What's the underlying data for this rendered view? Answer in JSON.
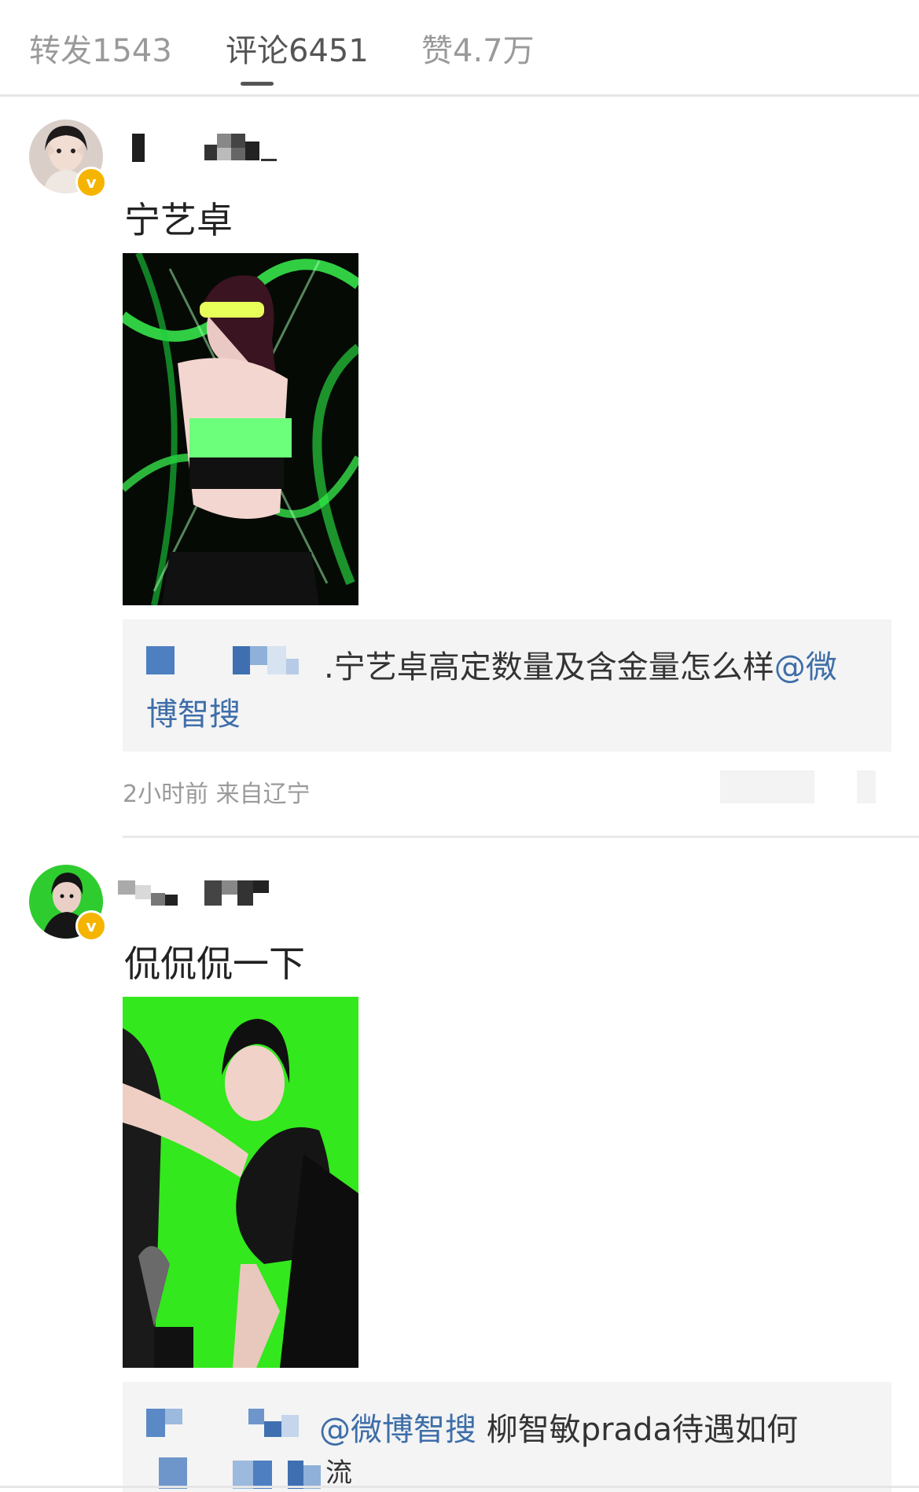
{
  "tabs": [
    {
      "label": "转发1543"
    },
    {
      "label": "评论6451"
    },
    {
      "label": "赞4.7万"
    }
  ],
  "comments": [
    {
      "text": "宁艺卓",
      "reply_prefix": ".宁艺卓高定数量及含金量怎么样",
      "reply_mention": "@微",
      "reply_mention2": "博智搜",
      "meta": "2小时前 来自辽宁"
    },
    {
      "text": "侃侃侃一下",
      "reply_mention": "@微博智搜",
      "reply_suffix": " 柳智敏prada待遇如何",
      "reply_tail": "流"
    }
  ],
  "colors": {
    "accent_link": "#3e6ea8",
    "badge": "#f5b400",
    "tab_inactive": "#9a9a9a",
    "tab_active": "#555555"
  }
}
